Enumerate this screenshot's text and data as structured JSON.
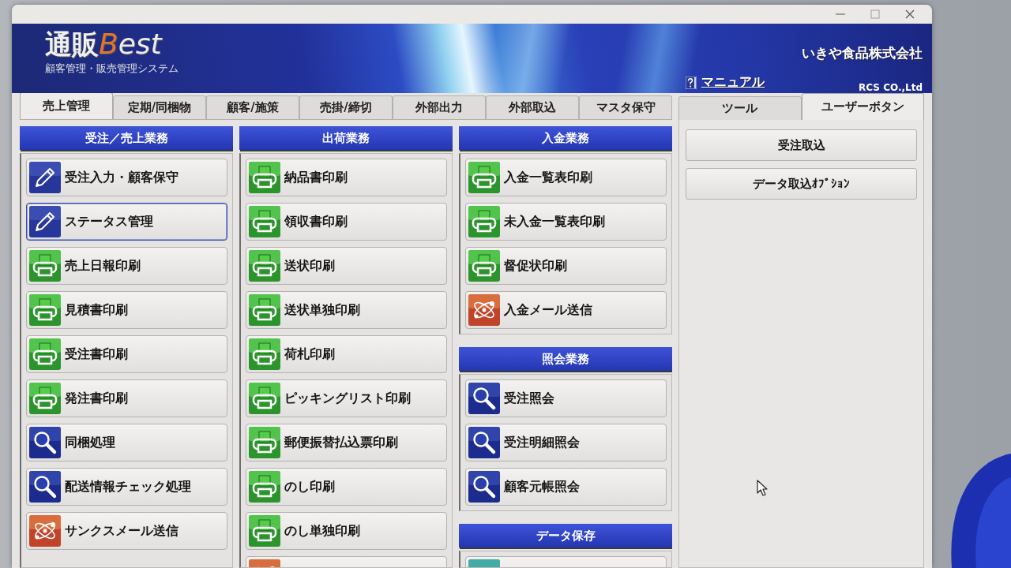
{
  "banner": {
    "logo_name": "通販",
    "logo_accent": "Best",
    "subtitle": "顧客管理・販売管理システム",
    "company": "いきや食品株式会社",
    "manual_link": "マニュアル",
    "vendor": "RCS CO.,Ltd"
  },
  "tabs": [
    {
      "label": "売上管理",
      "selected": true
    },
    {
      "label": "定期/同梱物",
      "selected": false
    },
    {
      "label": "顧客/施策",
      "selected": false
    },
    {
      "label": "売掛/締切",
      "selected": false
    },
    {
      "label": "外部出力",
      "selected": false
    },
    {
      "label": "外部取込",
      "selected": false
    },
    {
      "label": "マスタ保守",
      "selected": false
    }
  ],
  "side_tabs": [
    {
      "label": "ツール",
      "selected": false
    },
    {
      "label": "ユーザーボタン",
      "selected": true
    }
  ],
  "columns": [
    {
      "groups": [
        {
          "title": "受注／売上業務",
          "buttons": [
            {
              "label": "受注入力・顧客保守",
              "kind": "pencil",
              "focused": false
            },
            {
              "label": "ステータス管理",
              "kind": "pencil",
              "focused": true
            },
            {
              "label": "売上日報印刷",
              "kind": "printer",
              "focused": false
            },
            {
              "label": "見積書印刷",
              "kind": "printer",
              "focused": false
            },
            {
              "label": "受注書印刷",
              "kind": "printer",
              "focused": false
            },
            {
              "label": "発注書印刷",
              "kind": "printer",
              "focused": false
            },
            {
              "label": "同梱処理",
              "kind": "search",
              "focused": false
            },
            {
              "label": "配送情報チェック処理",
              "kind": "search",
              "focused": false
            },
            {
              "label": "サンクスメール送信",
              "kind": "atom",
              "focused": false
            }
          ]
        }
      ]
    },
    {
      "groups": [
        {
          "title": "出荷業務",
          "buttons": [
            {
              "label": "納品書印刷",
              "kind": "printer",
              "focused": false
            },
            {
              "label": "領収書印刷",
              "kind": "printer",
              "focused": false
            },
            {
              "label": "送状印刷",
              "kind": "printer",
              "focused": false
            },
            {
              "label": "送状単独印刷",
              "kind": "printer",
              "focused": false
            },
            {
              "label": "荷札印刷",
              "kind": "printer",
              "focused": false
            },
            {
              "label": "ピッキングリスト印刷",
              "kind": "printer",
              "focused": false
            },
            {
              "label": "郵便振替払込票印刷",
              "kind": "printer",
              "focused": false
            },
            {
              "label": "のし印刷",
              "kind": "printer",
              "focused": false
            },
            {
              "label": "のし単独印刷",
              "kind": "printer",
              "focused": false
            },
            {
              "kind": "atom",
              "focused": false
            }
          ]
        }
      ]
    },
    {
      "groups": [
        {
          "title": "入金業務",
          "buttons": [
            {
              "label": "入金一覧表印刷",
              "kind": "printer",
              "focused": false
            },
            {
              "label": "未入金一覧表印刷",
              "kind": "printer",
              "focused": false
            },
            {
              "label": "督促状印刷",
              "kind": "printer",
              "focused": false
            },
            {
              "label": "入金メール送信",
              "kind": "atom",
              "focused": false
            }
          ]
        },
        {
          "title": "照会業務",
          "buttons": [
            {
              "label": "受注照会",
              "kind": "search",
              "focused": false
            },
            {
              "label": "受注明細照会",
              "kind": "search",
              "focused": false
            },
            {
              "label": "顧客元帳照会",
              "kind": "search",
              "focused": false
            }
          ]
        },
        {
          "title": "データ保存",
          "buttons": [
            {
              "kind": "tile",
              "focused": false
            }
          ]
        }
      ]
    }
  ],
  "side_buttons": [
    "受注取込",
    "データ取込ｵﾌﾟｼｮﾝ"
  ]
}
